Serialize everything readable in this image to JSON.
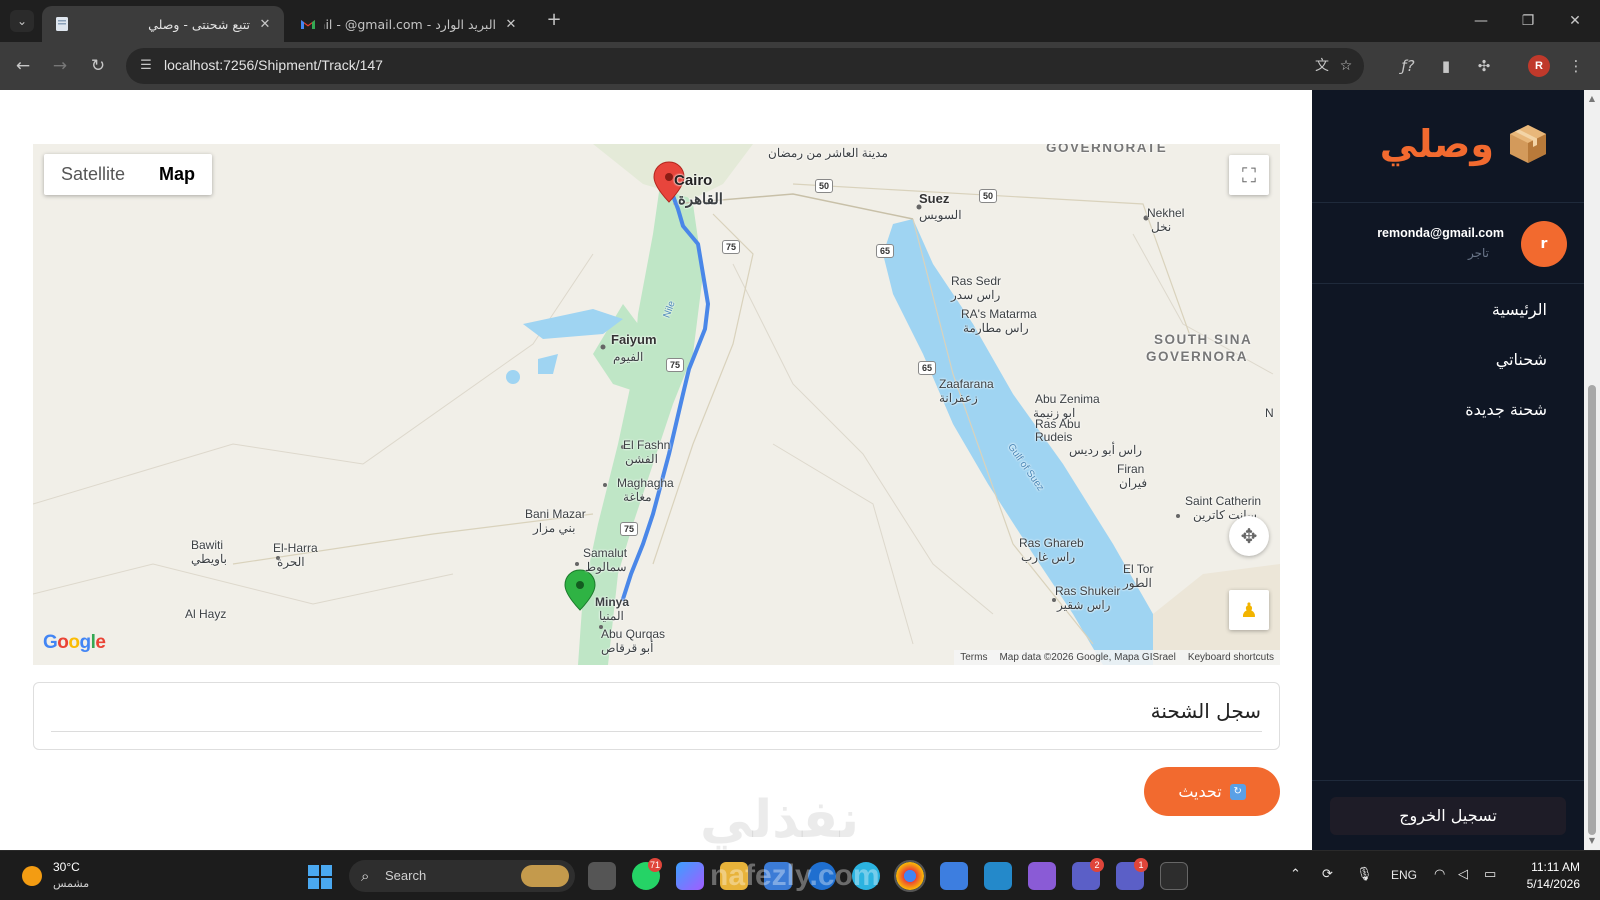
{
  "browser": {
    "tabs": [
      {
        "title": "تتبع شحنتى - وصلي",
        "active": true
      },
      {
        "title": "البريد الوارد - Gmail - @gmail.com",
        "active": false
      }
    ],
    "url": "localhost:7256/Shipment/Track/147",
    "profile_initial": "R"
  },
  "map": {
    "type_buttons": [
      "Satellite",
      "Map"
    ],
    "selected_type": "Map",
    "labels": {
      "cairo_en": "Cairo",
      "cairo_ar": "القاهرة",
      "ramadan_ar": "مدينة العاشر من رمضان",
      "suez_en": "Suez",
      "suez_ar": "السويس",
      "nekhel_en": "Nekhel",
      "nekhel_ar": "نخل",
      "faiyum_en": "Faiyum",
      "faiyum_ar": "الفيوم",
      "ras_sedr_en": "Ras Sedr",
      "ras_sedr_ar": "راس سدر",
      "ras_matarma_en": "RA's Matarma",
      "ras_matarma_ar": "راس مطارمة",
      "zaafarana_en": "Zaafarana",
      "zaafarana_ar": "زعفرانة",
      "abu_zenima_en": "Abu Zenima",
      "abu_zenima_ar": "ابو زنيمة",
      "ras_abu_rudeis_en": "Ras Abu Rudeis",
      "ras_abu_rudeis_ar": "راس أبو رديس",
      "firan_en": "Firan",
      "firan_ar": "فيران",
      "saint_catherine_en": "Saint Catherin",
      "saint_catherine_ar": "سانت كاترين",
      "el_fashn_en": "El Fashn",
      "el_fashn_ar": "الفشن",
      "maghagha_en": "Maghagha",
      "maghagha_ar": "مغاغة",
      "bani_mazar_en": "Bani Mazar",
      "bani_mazar_ar": "بني مزار",
      "samalut_en": "Samalut",
      "samalut_ar": "سمالوط",
      "minya_en": "Minya",
      "minya_ar": "المنيا",
      "abu_qurqas_en": "Abu Qurqas",
      "abu_qurqas_ar": "أبو قرقاص",
      "bawiti_en": "Bawiti",
      "bawiti_ar": "باويطي",
      "el_harra_en": "El-Harra",
      "el_harra_ar": "الحرة",
      "al_hayz": "Al Hayz",
      "ras_ghareb_en": "Ras Ghareb",
      "ras_ghareb_ar": "راس غارب",
      "el_tor_en": "El Tor",
      "el_tor_ar": "الطور",
      "ras_shukeir_en": "Ras Shukeir",
      "ras_shukeir_ar": "راس شقير",
      "gulf_of_suez": "Gulf of Suez",
      "nile": "Nile",
      "governorate_top": "GOVERNORATE",
      "south_sinai_1": "SOUTH SINA",
      "south_sinai_2": "GOVERNORA",
      "edge_n": "N"
    },
    "road_shields": [
      "50",
      "50",
      "75",
      "65",
      "75",
      "65",
      "75"
    ],
    "google": "Google",
    "attribution": [
      "Terms",
      "Map data ©2026 Google, Mapa GISrael",
      "Keyboard shortcuts"
    ],
    "origin_color": "#e8453c",
    "destination_color": "#2fb344",
    "route_color": "#4a87e8"
  },
  "history": {
    "title": "سجل الشحنة"
  },
  "refresh_button": {
    "label": "تحديث",
    "icon": "refresh-icon"
  },
  "watermark": "نفذلي",
  "sidebar": {
    "brand": "وصلي",
    "user": {
      "initial": "r",
      "email": "remonda@gmail.com",
      "role": "تاجر"
    },
    "nav": [
      "الرئيسية",
      "شحناتي",
      "شحنة جديدة"
    ],
    "logout": "تسجيل الخروج",
    "accent": "#f26a2f"
  },
  "taskbar": {
    "weather_temp": "30°C",
    "weather_desc": "مشمس",
    "search": "Search",
    "badges": {
      "whatsapp": "71",
      "teams_1": "2",
      "teams_2": "1"
    },
    "lang": "ENG",
    "time": "11:11 AM",
    "date": "5/14/2026",
    "watermark": "nafezly.com"
  }
}
